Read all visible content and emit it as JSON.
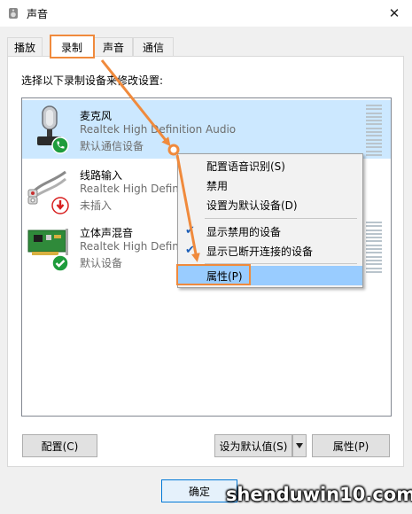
{
  "window": {
    "title": "声音",
    "close_glyph": "✕"
  },
  "tabs": [
    {
      "label": "播放",
      "active": false
    },
    {
      "label": "录制",
      "active": true
    },
    {
      "label": "声音",
      "active": false
    },
    {
      "label": "通信",
      "active": false
    }
  ],
  "instruction": "选择以下录制设备来修改设置:",
  "devices": [
    {
      "name": "麦克风",
      "driver": "Realtek High Definition Audio",
      "status": "默认通信设备",
      "icon": "microphone-icon",
      "badge": "phone-badge-icon",
      "selected": true
    },
    {
      "name": "线路输入",
      "driver": "Realtek High Defin",
      "status": "未插入",
      "icon": "line-in-icon",
      "badge": "unplugged-badge-icon",
      "selected": false
    },
    {
      "name": "立体声混音",
      "driver": "Realtek High Defin",
      "status": "默认设备",
      "icon": "sound-card-icon",
      "badge": "check-badge-icon",
      "selected": false
    }
  ],
  "context_menu": {
    "items": [
      {
        "label": "配置语音识别(S)",
        "checked": false
      },
      {
        "label": "禁用",
        "checked": false
      },
      {
        "label": "设置为默认设备(D)",
        "checked": false
      },
      {
        "label": "显示禁用的设备",
        "checked": true
      },
      {
        "label": "显示已断开连接的设备",
        "checked": true
      },
      {
        "label": "属性(P)",
        "checked": false,
        "highlighted": true
      }
    ]
  },
  "buttons": {
    "configure": "配置(C)",
    "set_default": "设为默认值(S)",
    "properties": "属性(P)",
    "ok": "确定"
  },
  "watermark": "shenduwin10.com",
  "colors": {
    "selection": "#cce8ff",
    "annotation": "#f08a3c",
    "menu_highlight": "#99ccff",
    "status_green": "#1e9c3c",
    "status_red": "#d82020"
  }
}
